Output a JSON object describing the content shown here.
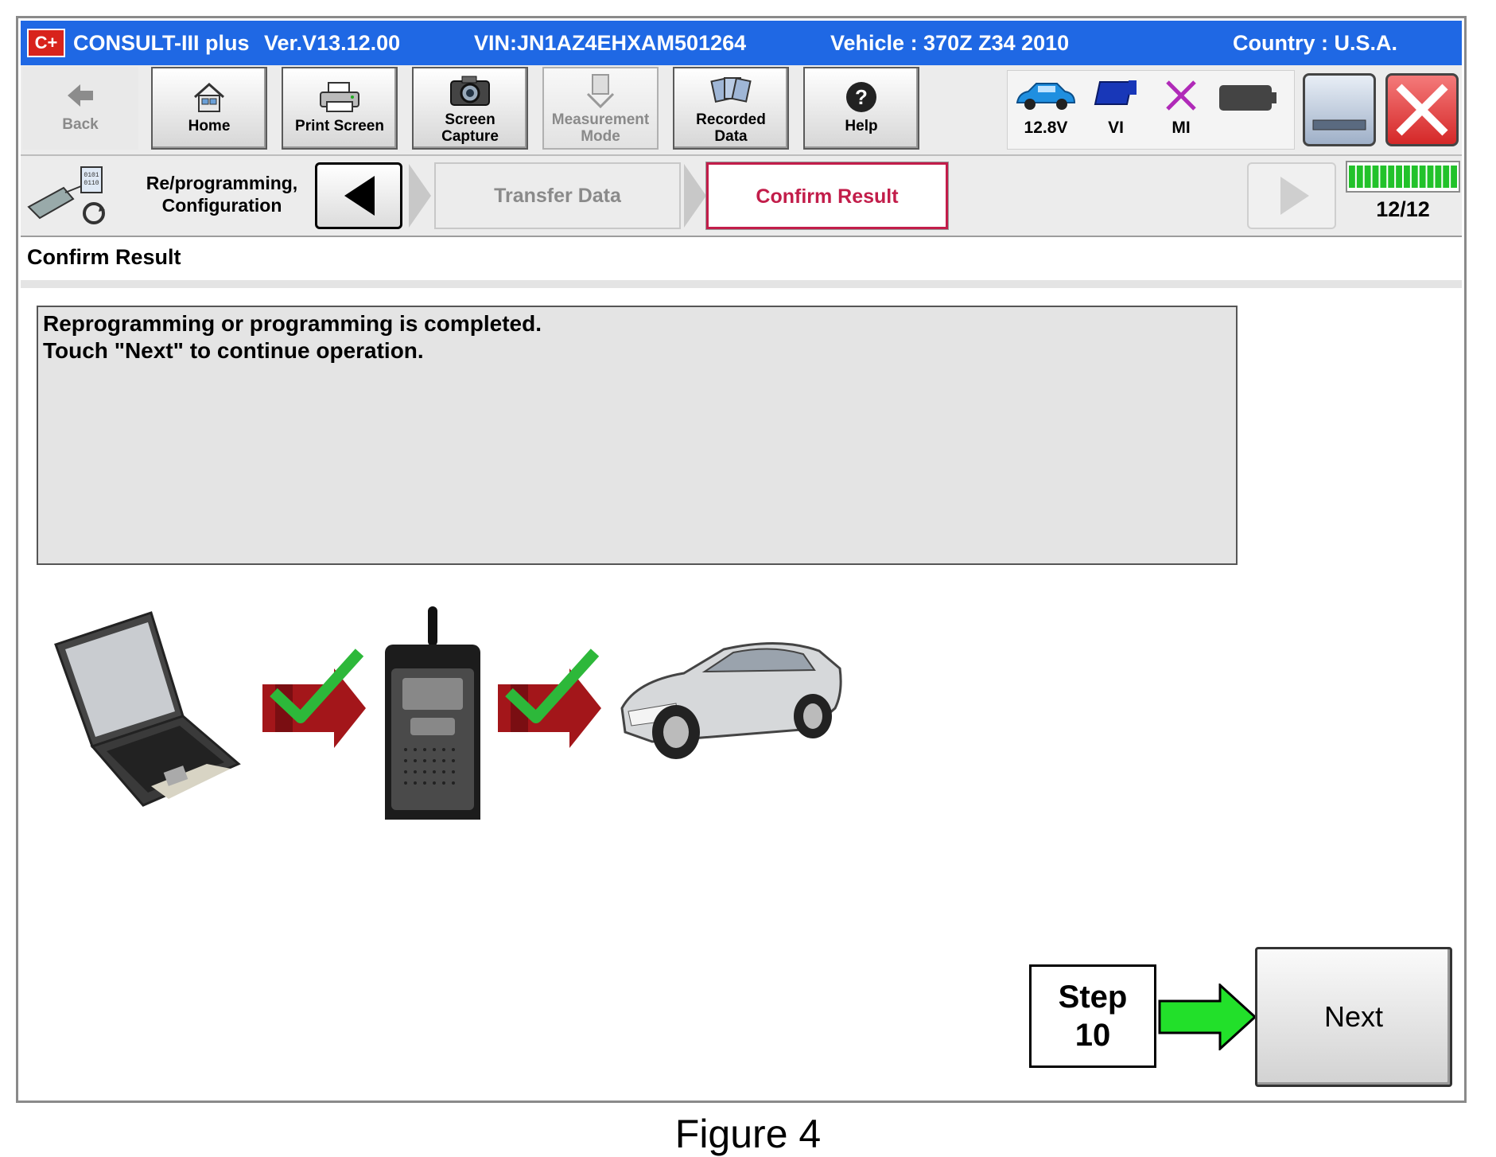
{
  "titlebar": {
    "logo": "C+",
    "app": "CONSULT-III plus",
    "version": "Ver.V13.12.00",
    "vin": "VIN:JN1AZ4EHXAM501264",
    "vehicle": "Vehicle : 370Z Z34 2010",
    "country": "Country : U.S.A."
  },
  "toolbar": {
    "back": "Back",
    "home": "Home",
    "print": "Print Screen",
    "capture_1": "Screen",
    "capture_2": "Capture",
    "measure_1": "Measurement",
    "measure_2": "Mode",
    "recorded_1": "Recorded",
    "recorded_2": "Data",
    "help": "Help"
  },
  "status": {
    "voltage": "12.8V",
    "vi": "VI",
    "mi": "MI"
  },
  "nav": {
    "label_1": "Re/programming,",
    "label_2": "Configuration",
    "crumb_prev": "Transfer Data",
    "crumb_current": "Confirm Result",
    "progress_text": "12/12",
    "progress_fraction": 1.0
  },
  "section_title": "Confirm Result",
  "message": {
    "line1": "Reprogramming or programming is completed.",
    "line2": "Touch \"Next\" to continue operation."
  },
  "step": {
    "line1": "Step",
    "line2": "10"
  },
  "next_label": "Next",
  "caption": "Figure 4",
  "colors": {
    "titlebar": "#1f68e4",
    "active_crumb": "#c21d4a",
    "close_button": "#e03a3a",
    "check_green": "#2db83a",
    "arrow_red": "#a3161a",
    "step_arrow": "#22e02a"
  }
}
